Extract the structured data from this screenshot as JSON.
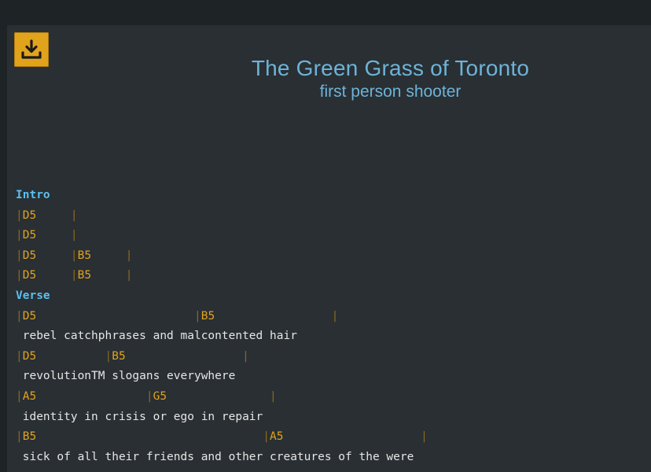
{
  "song": {
    "title": "The Green Grass of Toronto",
    "artist": "first person shooter"
  },
  "icons": {
    "download": "download-icon"
  },
  "colors": {
    "accent": "#e2a31c",
    "title": "#6eb3d8",
    "section": "#5bbfee",
    "lyric": "#e6e6e6",
    "panel": "#292f33"
  },
  "sheet": [
    {
      "type": "section",
      "text": "Intro"
    },
    {
      "type": "chords",
      "segments": [
        {
          "bar": "|",
          "chord": "D5",
          "pad": "     "
        },
        {
          "bar": "|",
          "chord": "",
          "pad": ""
        }
      ]
    },
    {
      "type": "chords",
      "segments": [
        {
          "bar": "|",
          "chord": "D5",
          "pad": "     "
        },
        {
          "bar": "|",
          "chord": "",
          "pad": ""
        }
      ]
    },
    {
      "type": "chords",
      "segments": [
        {
          "bar": "|",
          "chord": "D5",
          "pad": "     "
        },
        {
          "bar": "|",
          "chord": "B5",
          "pad": "     "
        },
        {
          "bar": "|",
          "chord": "",
          "pad": ""
        }
      ]
    },
    {
      "type": "chords",
      "segments": [
        {
          "bar": "|",
          "chord": "D5",
          "pad": "     "
        },
        {
          "bar": "|",
          "chord": "B5",
          "pad": "     "
        },
        {
          "bar": "|",
          "chord": "",
          "pad": ""
        }
      ]
    },
    {
      "type": "section",
      "text": "Verse"
    },
    {
      "type": "chords",
      "segments": [
        {
          "bar": "|",
          "chord": "D5",
          "pad": "                       "
        },
        {
          "bar": "|",
          "chord": "B5",
          "pad": "                 "
        },
        {
          "bar": "|",
          "chord": "",
          "pad": ""
        }
      ]
    },
    {
      "type": "lyric",
      "text": " rebel catchphrases and malcontented hair"
    },
    {
      "type": "chords",
      "segments": [
        {
          "bar": "|",
          "chord": "D5",
          "pad": "          "
        },
        {
          "bar": "|",
          "chord": "B5",
          "pad": "                 "
        },
        {
          "bar": "|",
          "chord": "",
          "pad": ""
        }
      ]
    },
    {
      "type": "lyric",
      "text": " revolutionTM slogans everywhere"
    },
    {
      "type": "chords",
      "segments": [
        {
          "bar": "|",
          "chord": "A5",
          "pad": "                "
        },
        {
          "bar": "|",
          "chord": "G5",
          "pad": "               "
        },
        {
          "bar": "|",
          "chord": "",
          "pad": ""
        }
      ]
    },
    {
      "type": "lyric",
      "text": " identity in crisis or ego in repair"
    },
    {
      "type": "chords",
      "segments": [
        {
          "bar": "|",
          "chord": "B5",
          "pad": "                                 "
        },
        {
          "bar": "|",
          "chord": "A5",
          "pad": "                    "
        },
        {
          "bar": "|",
          "chord": "",
          "pad": ""
        }
      ]
    },
    {
      "type": "lyric",
      "text": " sick of all their friends and other creatures of the were"
    }
  ]
}
